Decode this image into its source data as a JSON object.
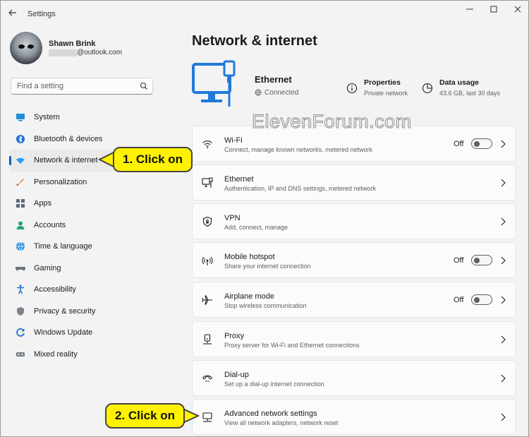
{
  "app": {
    "title": "Settings"
  },
  "user": {
    "name": "Shawn Brink",
    "email": "@outlook.com"
  },
  "search": {
    "placeholder": "Find a setting"
  },
  "sidebar": {
    "items": [
      {
        "label": "System",
        "icon": "system-icon"
      },
      {
        "label": "Bluetooth & devices",
        "icon": "bluetooth-icon"
      },
      {
        "label": "Network & internet",
        "icon": "wifi-icon",
        "selected": true
      },
      {
        "label": "Personalization",
        "icon": "brush-icon"
      },
      {
        "label": "Apps",
        "icon": "apps-icon"
      },
      {
        "label": "Accounts",
        "icon": "accounts-icon"
      },
      {
        "label": "Time & language",
        "icon": "globe-icon"
      },
      {
        "label": "Gaming",
        "icon": "gaming-icon"
      },
      {
        "label": "Accessibility",
        "icon": "accessibility-icon"
      },
      {
        "label": "Privacy & security",
        "icon": "shield-icon"
      },
      {
        "label": "Windows Update",
        "icon": "update-icon"
      },
      {
        "label": "Mixed reality",
        "icon": "headset-icon"
      }
    ]
  },
  "main": {
    "title": "Network & internet",
    "connection": {
      "name": "Ethernet",
      "status": "Connected",
      "properties": {
        "title": "Properties",
        "sub": "Private network"
      },
      "data_usage": {
        "title": "Data usage",
        "sub": "43.6 GB, last 30 days"
      }
    },
    "cards": [
      {
        "title": "Wi-Fi",
        "sub": "Connect, manage known networks, metered network",
        "icon": "wifi-icon",
        "toggle": "Off"
      },
      {
        "title": "Ethernet",
        "sub": "Authentication, IP and DNS settings, metered network",
        "icon": "ethernet-icon"
      },
      {
        "title": "VPN",
        "sub": "Add, connect, manage",
        "icon": "vpn-shield-icon"
      },
      {
        "title": "Mobile hotspot",
        "sub": "Share your internet connection",
        "icon": "hotspot-icon",
        "toggle": "Off"
      },
      {
        "title": "Airplane mode",
        "sub": "Stop wireless communication",
        "icon": "airplane-icon",
        "toggle": "Off"
      },
      {
        "title": "Proxy",
        "sub": "Proxy server for Wi-Fi and Ethernet connections",
        "icon": "proxy-icon"
      },
      {
        "title": "Dial-up",
        "sub": "Set up a dial-up internet connection",
        "icon": "dialup-icon"
      },
      {
        "title": "Advanced network settings",
        "sub": "View all network adapters, network reset",
        "icon": "advanced-network-icon"
      }
    ]
  },
  "watermark": "ElevenForum.com",
  "callouts": {
    "step1": "1. Click on",
    "step2": "2. Click on"
  },
  "colors": {
    "accent": "#005fb8",
    "callout": "#fff200"
  }
}
